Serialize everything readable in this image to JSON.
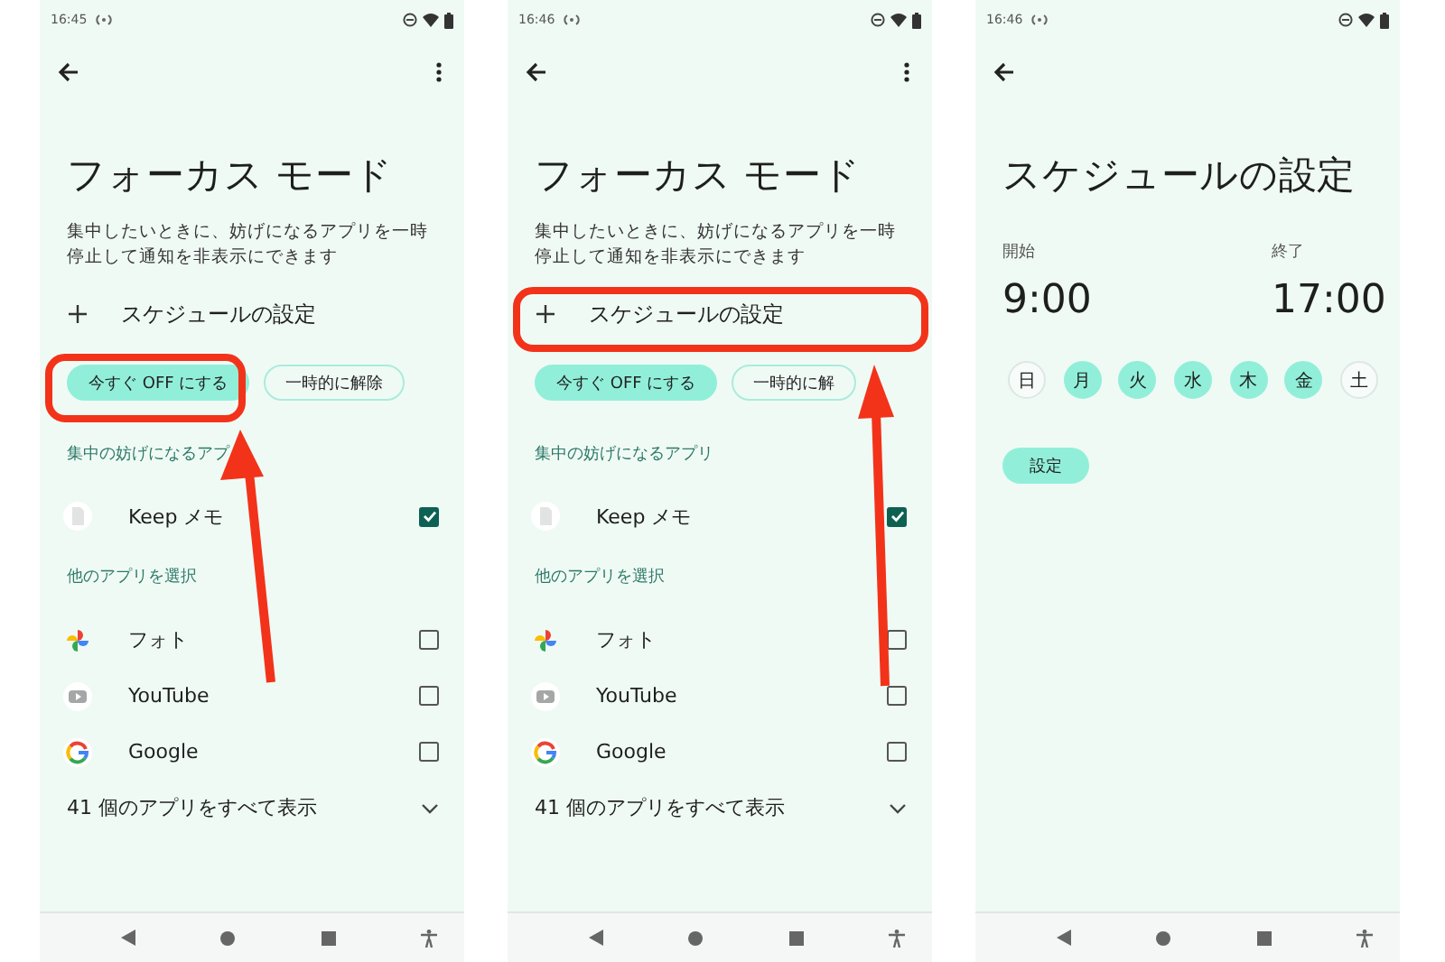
{
  "screens": [
    {
      "kind": "focus",
      "time": "16:45",
      "title": "フォーカス モード",
      "description": "集中したいときに、妨げになるアプリを一時停止して通知を非表示にできます",
      "schedule": "スケジュールの設定",
      "schedule_highlighted": false,
      "actions": [
        {
          "label": "今すぐ OFF にする",
          "primary": true,
          "highlighted": true
        },
        {
          "label": "一時的に解除",
          "primary": false,
          "highlighted": false
        }
      ],
      "focus_heading": "集中の妨げになるアプ",
      "focus_apps": [
        {
          "name": "Keep メモ",
          "kind": "notes",
          "checked": true
        }
      ],
      "other_heading": "他のアプリを選択",
      "other_apps": [
        {
          "name": "フォト",
          "kind": "photos",
          "checked": false
        },
        {
          "name": "YouTube",
          "kind": "video",
          "checked": false
        },
        {
          "name": "Google",
          "kind": "search",
          "checked": false
        }
      ],
      "show_all": "41 個のアプリをすべて表示"
    },
    {
      "kind": "focus",
      "time": "16:46",
      "title": "フォーカス モード",
      "description": "集中したいときに、妨げになるアプリを一時停止して通知を非表示にできます",
      "schedule": "スケジュールの設定",
      "schedule_highlighted": true,
      "actions": [
        {
          "label": "今すぐ OFF にする",
          "primary": true,
          "highlighted": false
        },
        {
          "label": "一時的に解",
          "primary": false,
          "highlighted": false
        }
      ],
      "focus_heading": "集中の妨げになるアプリ",
      "focus_apps": [
        {
          "name": "Keep メモ",
          "kind": "notes",
          "checked": true
        }
      ],
      "other_heading": "他のアプリを選択",
      "other_apps": [
        {
          "name": "フォト",
          "kind": "photos",
          "checked": false
        },
        {
          "name": "YouTube",
          "kind": "video",
          "checked": false
        },
        {
          "name": "Google",
          "kind": "search",
          "checked": false
        }
      ],
      "show_all": "41 個のアプリをすべて表示"
    },
    {
      "kind": "schedule",
      "time": "16:46",
      "title": "スケジュールの設定",
      "start_label": "開始",
      "start_time": "9:00",
      "end_label": "終了",
      "end_time": "17:00",
      "days": [
        {
          "label": "日",
          "selected": false
        },
        {
          "label": "月",
          "selected": true
        },
        {
          "label": "火",
          "selected": true
        },
        {
          "label": "水",
          "selected": true
        },
        {
          "label": "木",
          "selected": true
        },
        {
          "label": "金",
          "selected": true
        },
        {
          "label": "土",
          "selected": false
        }
      ],
      "save": "設定"
    }
  ]
}
